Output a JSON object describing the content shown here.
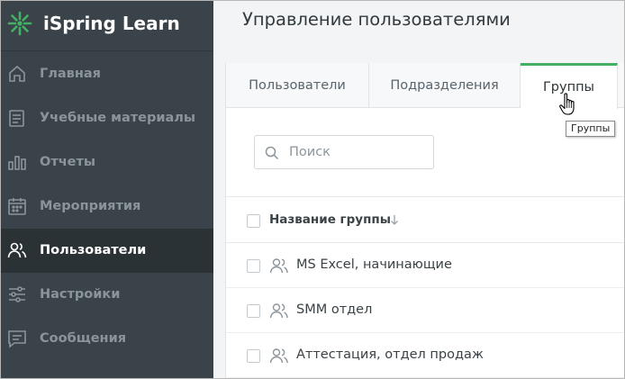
{
  "app": {
    "name": "iSpring Learn",
    "accent_color": "#43b063",
    "sidebar_bg": "#3a4349"
  },
  "sidebar": {
    "items": [
      {
        "label": "Главная",
        "icon": "home-icon",
        "active": false
      },
      {
        "label": "Учебные материалы",
        "icon": "documents-icon",
        "active": false
      },
      {
        "label": "Отчеты",
        "icon": "bar-chart-icon",
        "active": false
      },
      {
        "label": "Мероприятия",
        "icon": "calendar-icon",
        "active": false
      },
      {
        "label": "Пользователи",
        "icon": "users-icon",
        "active": true
      },
      {
        "label": "Настройки",
        "icon": "sliders-icon",
        "active": false
      },
      {
        "label": "Сообщения",
        "icon": "message-icon",
        "active": false
      }
    ]
  },
  "main": {
    "title": "Управление пользователями",
    "tabs": [
      {
        "label": "Пользователи",
        "active": false
      },
      {
        "label": "Подразделения",
        "active": false
      },
      {
        "label": "Группы",
        "active": true
      }
    ],
    "search": {
      "placeholder": "Поиск"
    },
    "table": {
      "header": "Название группы",
      "rows": [
        {
          "name": "MS Excel, начинающие"
        },
        {
          "name": "SMM отдел"
        },
        {
          "name": "Аттестация, отдел продаж"
        }
      ]
    }
  },
  "tooltip": {
    "text": "Группы"
  }
}
